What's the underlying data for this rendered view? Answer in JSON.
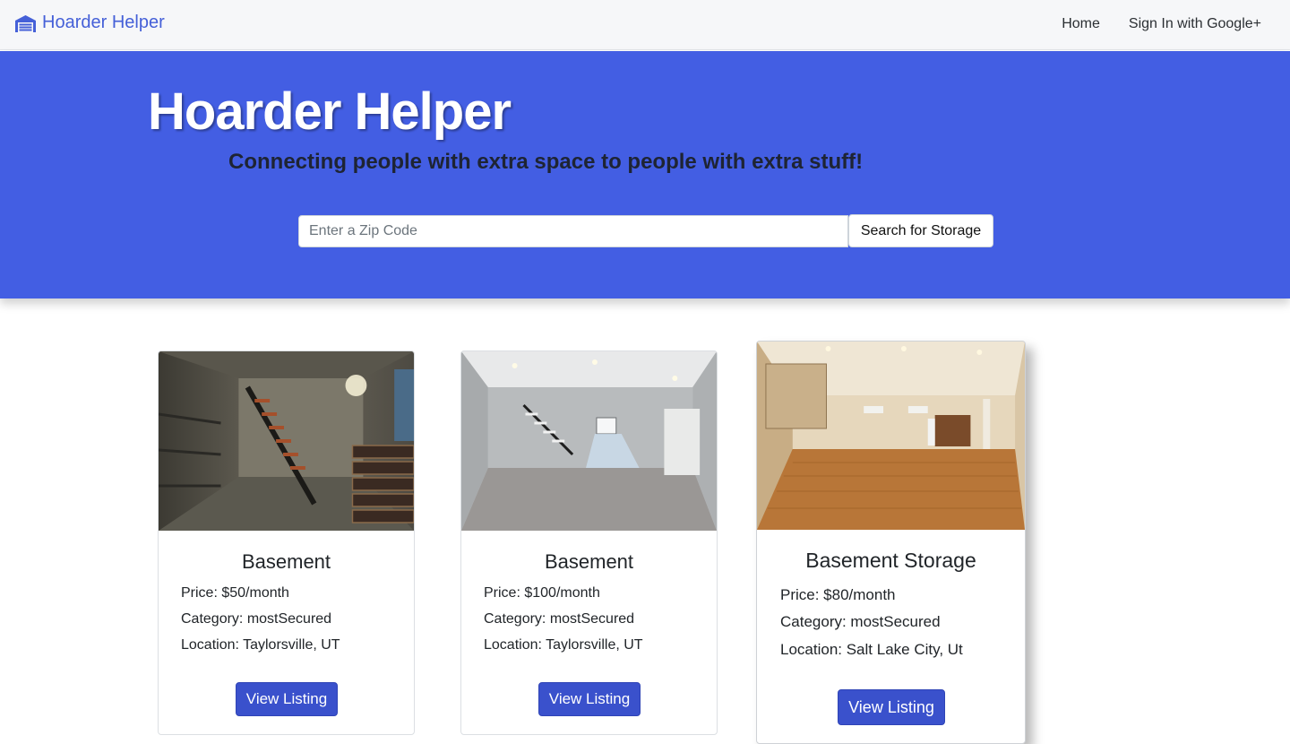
{
  "nav": {
    "brand": "Hoarder Helper",
    "links": [
      "Home",
      "Sign In with Google+"
    ]
  },
  "hero": {
    "title": "Hoarder Helper",
    "subtitle": "Connecting people with extra space to people with extra stuff!",
    "search_placeholder": "Enter a Zip Code",
    "search_button": "Search for Storage"
  },
  "listings": [
    {
      "title": "Basement",
      "price": "Price: $50/month",
      "category": "Category: mostSecured",
      "location": "Location: Taylorsville, UT",
      "button": "View Listing",
      "image": "dark concrete basement with stairs and shelving"
    },
    {
      "title": "Basement",
      "price": "Price: $100/month",
      "category": "Category: mostSecured",
      "location": "Location: Taylorsville, UT",
      "button": "View Listing",
      "image": "finished carpeted basement with stairs and window"
    },
    {
      "title": "Basement Storage",
      "price": "Price: $80/month",
      "category": "Category: mostSecured",
      "location": "Location: Salt Lake City, Ut",
      "button": "View Listing",
      "image": "finished basement with wood floor"
    }
  ],
  "colors": {
    "hero_bg": "#435ee3",
    "brand": "#4560d8",
    "button_bg": "#3a51cc"
  },
  "icons": {
    "brand_icon": "garage-icon"
  }
}
